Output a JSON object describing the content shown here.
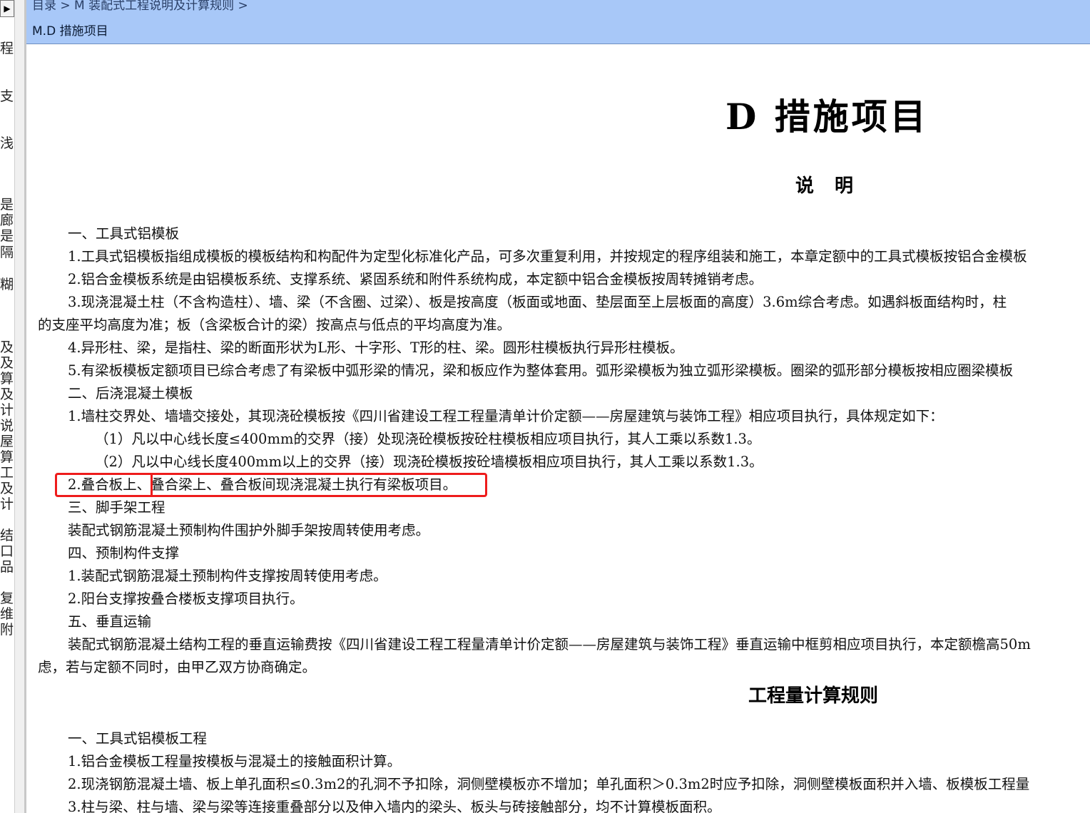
{
  "header": {
    "breadcrumb": "目录 > M 装配式工程说明及计算规则 >",
    "section_code": "M.D 措施项目"
  },
  "left_pane": {
    "toggle_glyph": "▶",
    "fragments": [
      "程",
      "支",
      "浅",
      "是",
      "廊",
      "是",
      "隔",
      "糊",
      "及",
      "及",
      "算",
      "及",
      "计",
      "说",
      "屋",
      "算",
      "工",
      "及",
      "计",
      "结",
      "口",
      "品",
      "复",
      "维",
      "附"
    ]
  },
  "document": {
    "chapter_title": "D 措施项目",
    "explain_title": "说 明",
    "lines": [
      "一、工具式铝模板",
      "1.工具式铝模板指组成模板的模板结构和构配件为定型化标准化产品，可多次重复利用，并按规定的程序组装和施工，本章定额中的工具式模板按铝合金模板",
      "2.铝合金模板系统是由铝模板系统、支撑系统、紧固系统和附件系统构成，本定额中铝合金模板按周转摊销考虑。",
      "3.现浇混凝土柱（不含构造柱）、墙、梁（不含圈、过梁）、板是按高度（板面或地面、垫层面至上层板面的高度）3.6m综合考虑。如遇斜板面结构时，柱",
      "的支座平均高度为准；板（含梁板合计的梁）按高点与低点的平均高度为准。",
      "4.异形柱、梁，是指柱、梁的断面形状为L形、十字形、T形的柱、梁。圆形柱模板执行异形柱模板。",
      "5.有梁板模板定额项目已综合考虑了有梁板中弧形梁的情况，梁和板应作为整体套用。弧形梁模板为独立弧形梁模板。圈梁的弧形部分模板按相应圈梁模板",
      "二、后浇混凝土模板",
      "1.墙柱交界处、墙墙交接处，其现浇砼模板按《四川省建设工程工程量清单计价定额——房屋建筑与装饰工程》相应项目执行，具体规定如下：",
      "（1）凡以中心线长度≤400mm的交界（接）处现浇砼模板按砼柱模板相应项目执行，其人工乘以系数1.3。",
      "（2）凡以中心线长度400mm以上的交界（接）现浇砼模板按砼墙模板相应项目执行，其人工乘以系数1.3。",
      "2.叠合板上、叠合梁上、叠合板间现浇混凝土执行有梁板项目。",
      "三、脚手架工程",
      "装配式钢筋混凝土预制构件围护外脚手架按周转使用考虑。",
      "四、预制构件支撑",
      "1.装配式钢筋混凝土预制构件支撑按周转使用考虑。",
      "2.阳台支撑按叠合楼板支撑项目执行。",
      "五、垂直运输",
      "装配式钢筋混凝土结构工程的垂直运输费按《四川省建设工程工程量清单计价定额——房屋建筑与装饰工程》垂直运输中框剪相应项目执行，本定额檐高50m",
      "虑，若与定额不同时，由甲乙双方协商确定。"
    ],
    "rules_title": "工程量计算规则",
    "rule_lines": [
      "一、工具式铝模板工程",
      "1.铝合金模板工程量按模板与混凝土的接触面积计算。",
      "2.现浇钢筋混凝土墙、板上单孔面积≤0.3m2的孔洞不予扣除，洞侧壁模板亦不增加；单孔面积＞0.3m2时应予扣除，洞侧壁模板面积并入墙、板模板工程量",
      "3.柱与梁、柱与墙、梁与梁等连接重叠部分以及伸入墙内的梁头、板头与砖接触部分，均不计算模板面积。"
    ]
  },
  "colors": {
    "header_bg": "#a8c8f8",
    "highlight": "#ee1c1c"
  }
}
